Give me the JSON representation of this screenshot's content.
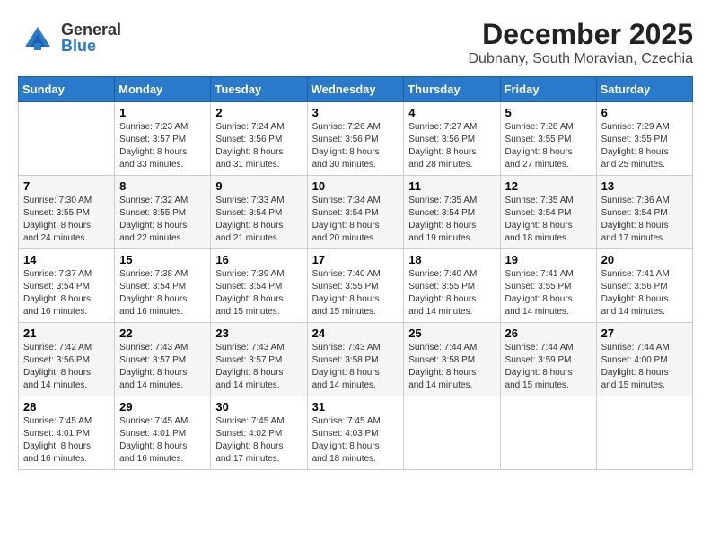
{
  "header": {
    "logo_general": "General",
    "logo_blue": "Blue",
    "month": "December 2025",
    "location": "Dubnany, South Moravian, Czechia"
  },
  "weekdays": [
    "Sunday",
    "Monday",
    "Tuesday",
    "Wednesday",
    "Thursday",
    "Friday",
    "Saturday"
  ],
  "weeks": [
    [
      {
        "day": "",
        "info": ""
      },
      {
        "day": "1",
        "info": "Sunrise: 7:23 AM\nSunset: 3:57 PM\nDaylight: 8 hours\nand 33 minutes."
      },
      {
        "day": "2",
        "info": "Sunrise: 7:24 AM\nSunset: 3:56 PM\nDaylight: 8 hours\nand 31 minutes."
      },
      {
        "day": "3",
        "info": "Sunrise: 7:26 AM\nSunset: 3:56 PM\nDaylight: 8 hours\nand 30 minutes."
      },
      {
        "day": "4",
        "info": "Sunrise: 7:27 AM\nSunset: 3:56 PM\nDaylight: 8 hours\nand 28 minutes."
      },
      {
        "day": "5",
        "info": "Sunrise: 7:28 AM\nSunset: 3:55 PM\nDaylight: 8 hours\nand 27 minutes."
      },
      {
        "day": "6",
        "info": "Sunrise: 7:29 AM\nSunset: 3:55 PM\nDaylight: 8 hours\nand 25 minutes."
      }
    ],
    [
      {
        "day": "7",
        "info": "Sunrise: 7:30 AM\nSunset: 3:55 PM\nDaylight: 8 hours\nand 24 minutes."
      },
      {
        "day": "8",
        "info": "Sunrise: 7:32 AM\nSunset: 3:55 PM\nDaylight: 8 hours\nand 22 minutes."
      },
      {
        "day": "9",
        "info": "Sunrise: 7:33 AM\nSunset: 3:54 PM\nDaylight: 8 hours\nand 21 minutes."
      },
      {
        "day": "10",
        "info": "Sunrise: 7:34 AM\nSunset: 3:54 PM\nDaylight: 8 hours\nand 20 minutes."
      },
      {
        "day": "11",
        "info": "Sunrise: 7:35 AM\nSunset: 3:54 PM\nDaylight: 8 hours\nand 19 minutes."
      },
      {
        "day": "12",
        "info": "Sunrise: 7:35 AM\nSunset: 3:54 PM\nDaylight: 8 hours\nand 18 minutes."
      },
      {
        "day": "13",
        "info": "Sunrise: 7:36 AM\nSunset: 3:54 PM\nDaylight: 8 hours\nand 17 minutes."
      }
    ],
    [
      {
        "day": "14",
        "info": "Sunrise: 7:37 AM\nSunset: 3:54 PM\nDaylight: 8 hours\nand 16 minutes."
      },
      {
        "day": "15",
        "info": "Sunrise: 7:38 AM\nSunset: 3:54 PM\nDaylight: 8 hours\nand 16 minutes."
      },
      {
        "day": "16",
        "info": "Sunrise: 7:39 AM\nSunset: 3:54 PM\nDaylight: 8 hours\nand 15 minutes."
      },
      {
        "day": "17",
        "info": "Sunrise: 7:40 AM\nSunset: 3:55 PM\nDaylight: 8 hours\nand 15 minutes."
      },
      {
        "day": "18",
        "info": "Sunrise: 7:40 AM\nSunset: 3:55 PM\nDaylight: 8 hours\nand 14 minutes."
      },
      {
        "day": "19",
        "info": "Sunrise: 7:41 AM\nSunset: 3:55 PM\nDaylight: 8 hours\nand 14 minutes."
      },
      {
        "day": "20",
        "info": "Sunrise: 7:41 AM\nSunset: 3:56 PM\nDaylight: 8 hours\nand 14 minutes."
      }
    ],
    [
      {
        "day": "21",
        "info": "Sunrise: 7:42 AM\nSunset: 3:56 PM\nDaylight: 8 hours\nand 14 minutes."
      },
      {
        "day": "22",
        "info": "Sunrise: 7:43 AM\nSunset: 3:57 PM\nDaylight: 8 hours\nand 14 minutes."
      },
      {
        "day": "23",
        "info": "Sunrise: 7:43 AM\nSunset: 3:57 PM\nDaylight: 8 hours\nand 14 minutes."
      },
      {
        "day": "24",
        "info": "Sunrise: 7:43 AM\nSunset: 3:58 PM\nDaylight: 8 hours\nand 14 minutes."
      },
      {
        "day": "25",
        "info": "Sunrise: 7:44 AM\nSunset: 3:58 PM\nDaylight: 8 hours\nand 14 minutes."
      },
      {
        "day": "26",
        "info": "Sunrise: 7:44 AM\nSunset: 3:59 PM\nDaylight: 8 hours\nand 15 minutes."
      },
      {
        "day": "27",
        "info": "Sunrise: 7:44 AM\nSunset: 4:00 PM\nDaylight: 8 hours\nand 15 minutes."
      }
    ],
    [
      {
        "day": "28",
        "info": "Sunrise: 7:45 AM\nSunset: 4:01 PM\nDaylight: 8 hours\nand 16 minutes."
      },
      {
        "day": "29",
        "info": "Sunrise: 7:45 AM\nSunset: 4:01 PM\nDaylight: 8 hours\nand 16 minutes."
      },
      {
        "day": "30",
        "info": "Sunrise: 7:45 AM\nSunset: 4:02 PM\nDaylight: 8 hours\nand 17 minutes."
      },
      {
        "day": "31",
        "info": "Sunrise: 7:45 AM\nSunset: 4:03 PM\nDaylight: 8 hours\nand 18 minutes."
      },
      {
        "day": "",
        "info": ""
      },
      {
        "day": "",
        "info": ""
      },
      {
        "day": "",
        "info": ""
      }
    ]
  ]
}
